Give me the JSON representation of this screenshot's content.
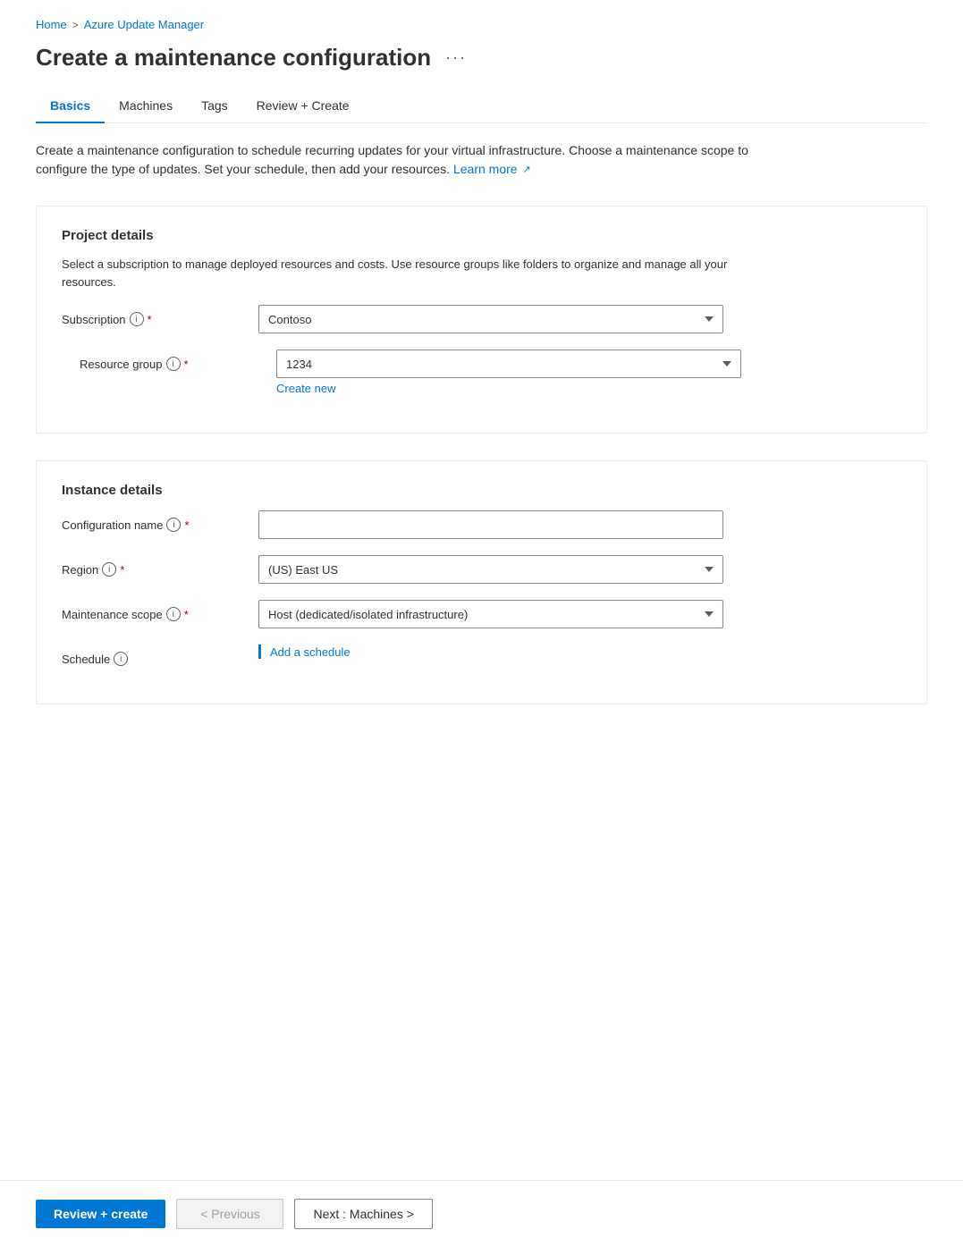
{
  "breadcrumb": {
    "home": "Home",
    "separator": ">",
    "parent": "Azure Update Manager"
  },
  "page": {
    "title": "Create a maintenance configuration",
    "ellipsis": "···"
  },
  "tabs": [
    {
      "id": "basics",
      "label": "Basics",
      "active": true
    },
    {
      "id": "machines",
      "label": "Machines",
      "active": false
    },
    {
      "id": "tags",
      "label": "Tags",
      "active": false
    },
    {
      "id": "review-create",
      "label": "Review + Create",
      "active": false
    }
  ],
  "description": {
    "text": "Create a maintenance configuration to schedule recurring updates for your virtual infrastructure. Choose a maintenance scope to configure the type of updates. Set your schedule, then add your resources.",
    "learn_more": "Learn more"
  },
  "project_details": {
    "heading": "Project details",
    "sub_text": "Select a subscription to manage deployed resources and costs. Use resource groups like folders to organize and manage all your resources.",
    "subscription": {
      "label": "Subscription",
      "required": true,
      "value": "Contoso",
      "options": [
        "Contoso"
      ]
    },
    "resource_group": {
      "label": "Resource group",
      "required": true,
      "value": "1234",
      "options": [
        "1234"
      ],
      "create_new": "Create new"
    }
  },
  "instance_details": {
    "heading": "Instance details",
    "config_name": {
      "label": "Configuration name",
      "required": true,
      "placeholder": "",
      "value": ""
    },
    "region": {
      "label": "Region",
      "required": true,
      "value": "(US) East US",
      "options": [
        "(US) East US"
      ]
    },
    "maintenance_scope": {
      "label": "Maintenance scope",
      "required": true,
      "value": "Host (dedicated/isolated infrastructure)",
      "options": [
        "Host (dedicated/isolated infrastructure)"
      ]
    },
    "schedule": {
      "label": "Schedule",
      "add_link": "Add a schedule"
    }
  },
  "footer": {
    "review_create": "Review + create",
    "previous": "< Previous",
    "next": "Next : Machines >"
  }
}
